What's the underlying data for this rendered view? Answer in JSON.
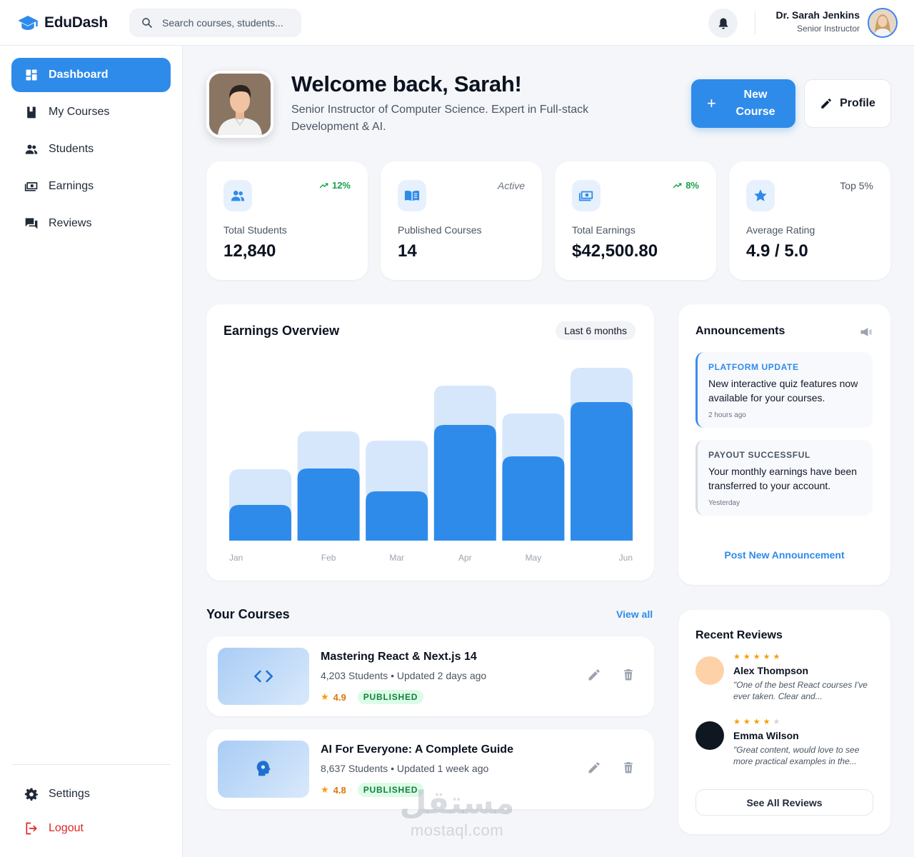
{
  "app": {
    "name": "EduDash",
    "accent": "#2f8bea"
  },
  "search": {
    "placeholder": "Search courses, students..."
  },
  "user": {
    "name": "Dr. Sarah Jenkins",
    "role": "Senior Instructor"
  },
  "sidebar": {
    "items": [
      {
        "label": "Dashboard",
        "icon": "dashboard-icon",
        "active": true
      },
      {
        "label": "My Courses",
        "icon": "book-icon"
      },
      {
        "label": "Students",
        "icon": "people-icon"
      },
      {
        "label": "Earnings",
        "icon": "cash-icon"
      },
      {
        "label": "Reviews",
        "icon": "chat-icon"
      }
    ],
    "settings": "Settings",
    "logout": "Logout"
  },
  "hero": {
    "title": "Welcome back, Sarah!",
    "subtitle": "Senior Instructor of Computer Science. Expert in Full-stack Development & AI.",
    "new_course": "New Course",
    "profile": "Profile"
  },
  "stats": [
    {
      "label": "Total Students",
      "value": "12,840",
      "badge": "12%",
      "icon": "people-icon"
    },
    {
      "label": "Published Courses",
      "value": "14",
      "badge": "Active",
      "icon": "book-open-icon"
    },
    {
      "label": "Total Earnings",
      "value": "$42,500.80",
      "badge": "8%",
      "icon": "cash-icon"
    },
    {
      "label": "Average Rating",
      "value": "4.9 / 5.0",
      "badge": "Top 5%",
      "icon": "star-icon"
    }
  ],
  "earnings": {
    "title": "Earnings Overview",
    "range": "Last 6 months"
  },
  "chart_data": {
    "type": "bar",
    "title": "Earnings Overview",
    "categories": [
      "Jan",
      "Feb",
      "Mar",
      "Apr",
      "May",
      "Jun"
    ],
    "series": [
      {
        "values": [
          100,
          153,
          140,
          217,
          178,
          242
        ]
      },
      {
        "values": [
          50,
          101,
          69,
          162,
          118,
          194
        ]
      }
    ],
    "ylim": [
      0,
      242
    ],
    "grid": false,
    "colors": [
      "#d6e7fb",
      "#2f8bea"
    ]
  },
  "announcements": {
    "title": "Announcements",
    "items": [
      {
        "tag": "PLATFORM UPDATE",
        "message": "New interactive quiz features now available for your courses.",
        "time": "2 hours ago"
      },
      {
        "tag": "PAYOUT SUCCESSFUL",
        "message": "Your monthly earnings have been transferred to your account.",
        "time": "Yesterday"
      }
    ],
    "post_label": "Post New Announcement"
  },
  "courses": {
    "title": "Your Courses",
    "view_all": "View all",
    "items": [
      {
        "title": "Mastering React & Next.js 14",
        "meta": "4,203 Students • Updated 2 days ago",
        "rating": "4.9",
        "status": "PUBLISHED",
        "icon": "code-icon"
      },
      {
        "title": "AI For Everyone: A Complete Guide",
        "meta": "8,637 Students • Updated 1 week ago",
        "rating": "4.8",
        "status": "PUBLISHED",
        "icon": "brain-icon"
      }
    ]
  },
  "reviews": {
    "title": "Recent Reviews",
    "items": [
      {
        "name": "Alex Thompson",
        "stars": 5,
        "text": "\"One of the best React courses I've ever taken. Clear and...",
        "avatar_color": "#fdd2a8"
      },
      {
        "name": "Emma Wilson",
        "stars": 4,
        "text": "\"Great content, would love to see more practical examples in the...",
        "avatar_color": "#0f1720"
      }
    ],
    "see_all": "See All Reviews"
  },
  "watermark": {
    "arabic": "مستقل",
    "latin": "mostaql.com"
  }
}
